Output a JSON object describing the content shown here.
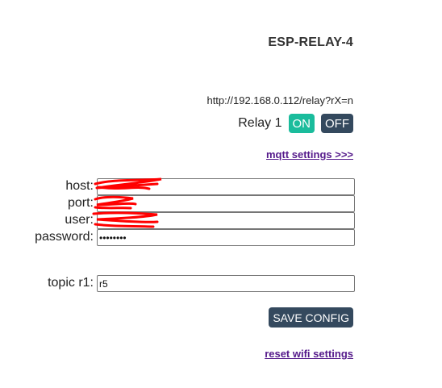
{
  "header": {
    "title": "ESP-RELAY-4"
  },
  "relay": {
    "url_hint": "http://192.168.0.112/relay?rX=n",
    "label": "Relay 1",
    "on_label": "ON",
    "off_label": "OFF"
  },
  "links": {
    "mqtt_settings": "mqtt settings >>>",
    "reset_wifi": "reset wifi settings"
  },
  "form": {
    "host": {
      "label": "host:",
      "value": ""
    },
    "port": {
      "label": "port:",
      "value": ""
    },
    "user": {
      "label": "user:",
      "value": ""
    },
    "password": {
      "label": "password:",
      "value": "••••••••"
    },
    "topic": {
      "label": "topic r1:",
      "value": "r5"
    }
  },
  "actions": {
    "save_label": "SAVE CONFIG"
  },
  "colors": {
    "on_button": "#1abc9c",
    "off_button": "#34495e",
    "link": "#551a8b",
    "redaction": "#ff0000"
  }
}
